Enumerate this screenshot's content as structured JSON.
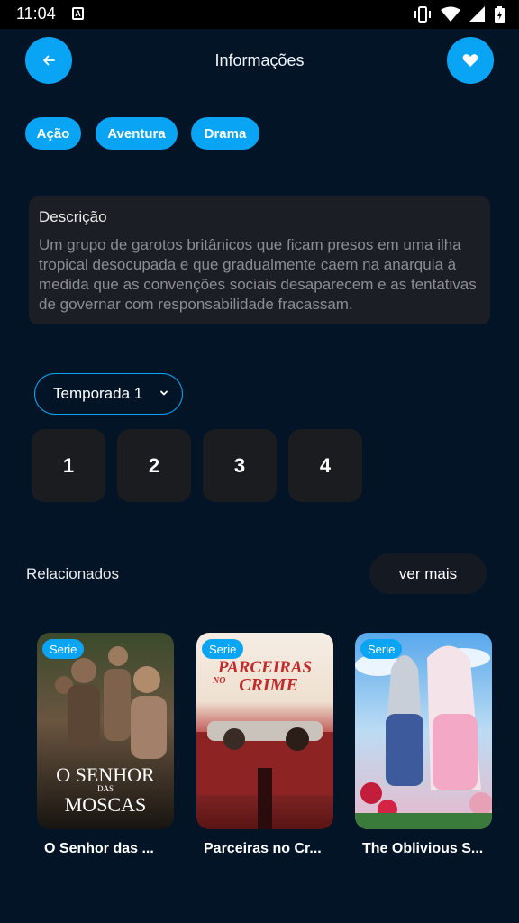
{
  "status_bar": {
    "time": "11:04",
    "notification_icon": "A"
  },
  "header": {
    "title": "Informações",
    "back_icon": "arrow-left-icon",
    "favorite_icon": "heart-icon"
  },
  "genres": [
    "Ação",
    "Aventura",
    "Drama"
  ],
  "description": {
    "title": "Descrição",
    "text": "Um grupo de garotos britânicos que ficam presos em uma ilha tropical desocupada e que gradualmente caem na anarquia à medida que as convenções sociais desaparecem e as tentativas de governar com responsabilidade fracassam."
  },
  "season": {
    "selected": "Temporada 1"
  },
  "episodes": [
    "1",
    "2",
    "3",
    "4"
  ],
  "related": {
    "title": "Relacionados",
    "see_more": "ver mais",
    "items": [
      {
        "badge": "Serie",
        "title": "O Senhor das ...",
        "poster_text": [
          "O SENHOR",
          "DAS",
          "MOSCAS"
        ]
      },
      {
        "badge": "Serie",
        "title": "Parceiras no Cr...",
        "poster_text": [
          "PARCEIRAS",
          "NO",
          "CRIME"
        ]
      },
      {
        "badge": "Serie",
        "title": "The Oblivious S...",
        "poster_text": []
      }
    ]
  },
  "colors": {
    "background": "#031427",
    "accent": "#0aa4f5",
    "card": "#1b1e24"
  }
}
